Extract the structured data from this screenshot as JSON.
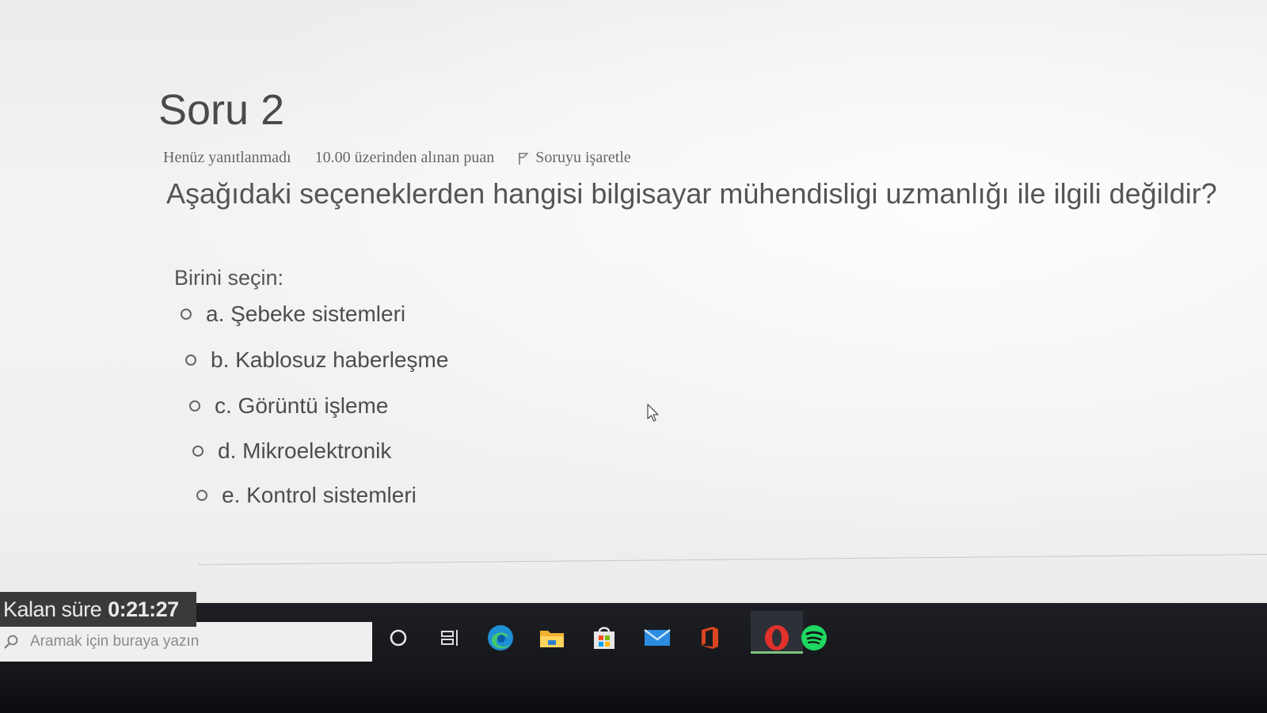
{
  "question": {
    "title": "Soru 2",
    "status": "Henüz yanıtlanmadı",
    "points": "10.00 üzerinden alınan puan",
    "flag_label": "Soruyu işaretle",
    "text": "Aşağıdaki seçeneklerden hangisi bilgisayar mühendisligi uzmanlığı ile ilgili değildir?",
    "prompt": "Birini seçin:",
    "options": [
      {
        "label": "a. Şebeke sistemleri"
      },
      {
        "label": "b. Kablosuz haberleşme"
      },
      {
        "label": "c. Görüntü işleme"
      },
      {
        "label": "d. Mikroelektronik"
      },
      {
        "label": "e. Kontrol sistemleri"
      }
    ]
  },
  "timer": {
    "label": "Kalan süre",
    "value": "0:21:27"
  },
  "taskbar": {
    "search_placeholder": "Aramak için buraya yazın",
    "icons": [
      "cortana-icon",
      "task-view-icon",
      "edge-icon",
      "file-explorer-icon",
      "store-icon",
      "mail-icon",
      "office-icon",
      "opera-icon",
      "spotify-icon"
    ]
  },
  "colors": {
    "spotify": "#1ed760",
    "opera": "#e0312b",
    "office": "#d9461f",
    "edge": "#1f8fd6"
  }
}
